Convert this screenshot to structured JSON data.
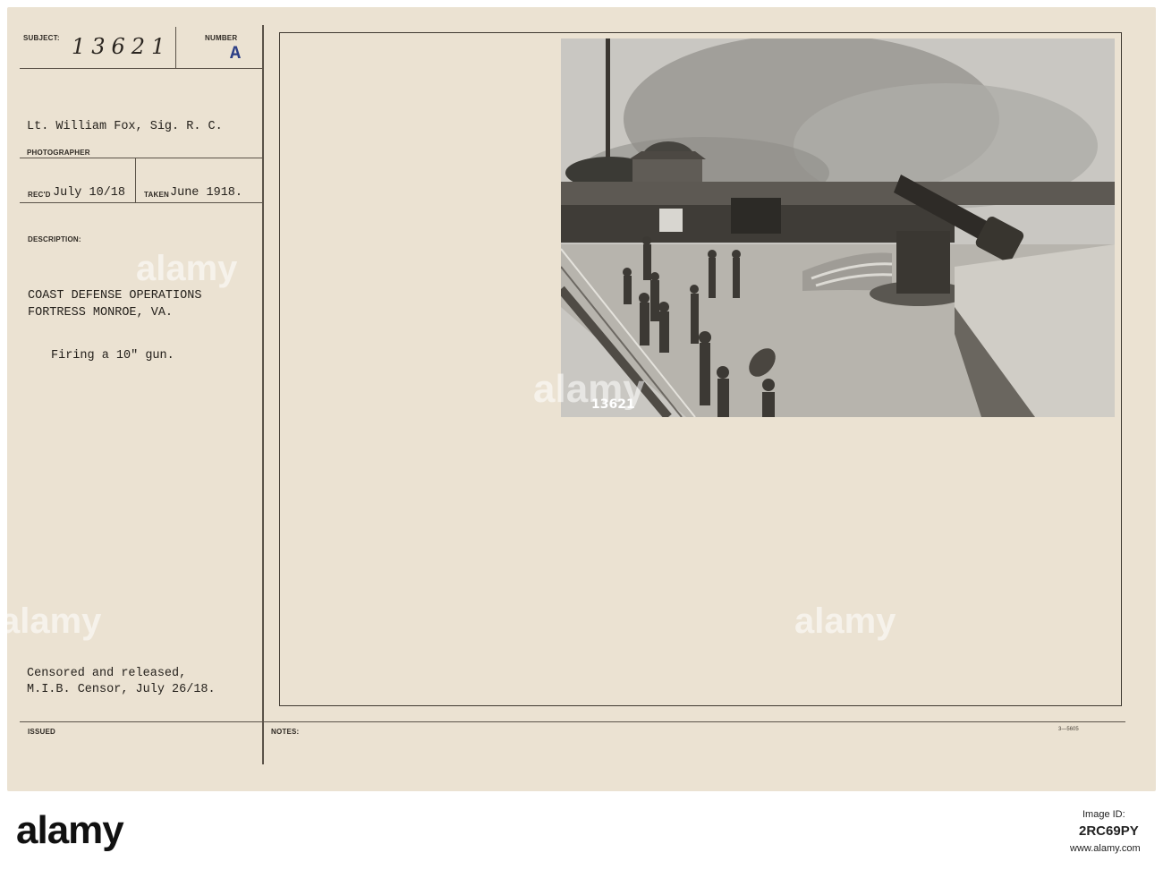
{
  "card": {
    "subject_label": "SUBJECT:",
    "subject_number": "13621",
    "number_label": "NUMBER",
    "number_value": "A",
    "photographer_name": "Lt. William Fox, Sig. R. C.",
    "photographer_label": "PHOTOGRAPHER",
    "recd_label": "REC'D",
    "recd_value": "July 10/18",
    "taken_label": "TAKEN",
    "taken_value": "June 1918.",
    "description_label": "DESCRIPTION:",
    "description_line1": "COAST DEFENSE OPERATIONS",
    "description_line2": "FORTRESS MONROE, VA.",
    "description_line3": "Firing a 10\" gun.",
    "censor_line1": "Censored and released,",
    "censor_line2": "M.I.B. Censor, July 26/18.",
    "issued_label": "ISSUED",
    "notes_label": "NOTES:",
    "form_number": "3—5605",
    "photo_number": "13621"
  },
  "watermark": "alamy",
  "footer": {
    "brand": "alamy",
    "image_id_label": "Image ID:",
    "image_id": "2RC69PY",
    "site": "www.alamy.com"
  },
  "colors": {
    "card": "#ebe2d2",
    "stamp_blue": "#2d3f86",
    "ink": "#25211c"
  }
}
